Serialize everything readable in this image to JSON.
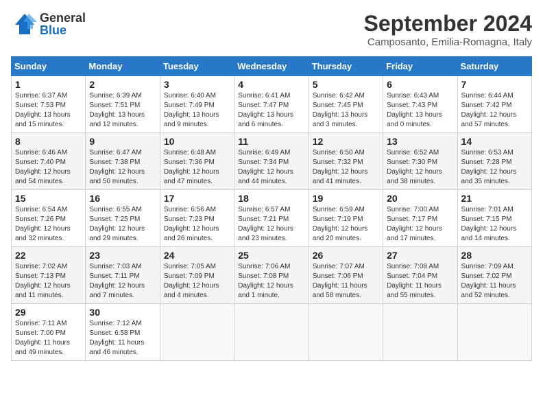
{
  "header": {
    "logo_general": "General",
    "logo_blue": "Blue",
    "title": "September 2024",
    "subtitle": "Camposanto, Emilia-Romagna, Italy"
  },
  "weekdays": [
    "Sunday",
    "Monday",
    "Tuesday",
    "Wednesday",
    "Thursday",
    "Friday",
    "Saturday"
  ],
  "weeks": [
    [
      {
        "day": "1",
        "sunrise": "Sunrise: 6:37 AM",
        "sunset": "Sunset: 7:53 PM",
        "daylight": "Daylight: 13 hours and 15 minutes."
      },
      {
        "day": "2",
        "sunrise": "Sunrise: 6:39 AM",
        "sunset": "Sunset: 7:51 PM",
        "daylight": "Daylight: 13 hours and 12 minutes."
      },
      {
        "day": "3",
        "sunrise": "Sunrise: 6:40 AM",
        "sunset": "Sunset: 7:49 PM",
        "daylight": "Daylight: 13 hours and 9 minutes."
      },
      {
        "day": "4",
        "sunrise": "Sunrise: 6:41 AM",
        "sunset": "Sunset: 7:47 PM",
        "daylight": "Daylight: 13 hours and 6 minutes."
      },
      {
        "day": "5",
        "sunrise": "Sunrise: 6:42 AM",
        "sunset": "Sunset: 7:45 PM",
        "daylight": "Daylight: 13 hours and 3 minutes."
      },
      {
        "day": "6",
        "sunrise": "Sunrise: 6:43 AM",
        "sunset": "Sunset: 7:43 PM",
        "daylight": "Daylight: 13 hours and 0 minutes."
      },
      {
        "day": "7",
        "sunrise": "Sunrise: 6:44 AM",
        "sunset": "Sunset: 7:42 PM",
        "daylight": "Daylight: 12 hours and 57 minutes."
      }
    ],
    [
      {
        "day": "8",
        "sunrise": "Sunrise: 6:46 AM",
        "sunset": "Sunset: 7:40 PM",
        "daylight": "Daylight: 12 hours and 54 minutes."
      },
      {
        "day": "9",
        "sunrise": "Sunrise: 6:47 AM",
        "sunset": "Sunset: 7:38 PM",
        "daylight": "Daylight: 12 hours and 50 minutes."
      },
      {
        "day": "10",
        "sunrise": "Sunrise: 6:48 AM",
        "sunset": "Sunset: 7:36 PM",
        "daylight": "Daylight: 12 hours and 47 minutes."
      },
      {
        "day": "11",
        "sunrise": "Sunrise: 6:49 AM",
        "sunset": "Sunset: 7:34 PM",
        "daylight": "Daylight: 12 hours and 44 minutes."
      },
      {
        "day": "12",
        "sunrise": "Sunrise: 6:50 AM",
        "sunset": "Sunset: 7:32 PM",
        "daylight": "Daylight: 12 hours and 41 minutes."
      },
      {
        "day": "13",
        "sunrise": "Sunrise: 6:52 AM",
        "sunset": "Sunset: 7:30 PM",
        "daylight": "Daylight: 12 hours and 38 minutes."
      },
      {
        "day": "14",
        "sunrise": "Sunrise: 6:53 AM",
        "sunset": "Sunset: 7:28 PM",
        "daylight": "Daylight: 12 hours and 35 minutes."
      }
    ],
    [
      {
        "day": "15",
        "sunrise": "Sunrise: 6:54 AM",
        "sunset": "Sunset: 7:26 PM",
        "daylight": "Daylight: 12 hours and 32 minutes."
      },
      {
        "day": "16",
        "sunrise": "Sunrise: 6:55 AM",
        "sunset": "Sunset: 7:25 PM",
        "daylight": "Daylight: 12 hours and 29 minutes."
      },
      {
        "day": "17",
        "sunrise": "Sunrise: 6:56 AM",
        "sunset": "Sunset: 7:23 PM",
        "daylight": "Daylight: 12 hours and 26 minutes."
      },
      {
        "day": "18",
        "sunrise": "Sunrise: 6:57 AM",
        "sunset": "Sunset: 7:21 PM",
        "daylight": "Daylight: 12 hours and 23 minutes."
      },
      {
        "day": "19",
        "sunrise": "Sunrise: 6:59 AM",
        "sunset": "Sunset: 7:19 PM",
        "daylight": "Daylight: 12 hours and 20 minutes."
      },
      {
        "day": "20",
        "sunrise": "Sunrise: 7:00 AM",
        "sunset": "Sunset: 7:17 PM",
        "daylight": "Daylight: 12 hours and 17 minutes."
      },
      {
        "day": "21",
        "sunrise": "Sunrise: 7:01 AM",
        "sunset": "Sunset: 7:15 PM",
        "daylight": "Daylight: 12 hours and 14 minutes."
      }
    ],
    [
      {
        "day": "22",
        "sunrise": "Sunrise: 7:02 AM",
        "sunset": "Sunset: 7:13 PM",
        "daylight": "Daylight: 12 hours and 11 minutes."
      },
      {
        "day": "23",
        "sunrise": "Sunrise: 7:03 AM",
        "sunset": "Sunset: 7:11 PM",
        "daylight": "Daylight: 12 hours and 7 minutes."
      },
      {
        "day": "24",
        "sunrise": "Sunrise: 7:05 AM",
        "sunset": "Sunset: 7:09 PM",
        "daylight": "Daylight: 12 hours and 4 minutes."
      },
      {
        "day": "25",
        "sunrise": "Sunrise: 7:06 AM",
        "sunset": "Sunset: 7:08 PM",
        "daylight": "Daylight: 12 hours and 1 minute."
      },
      {
        "day": "26",
        "sunrise": "Sunrise: 7:07 AM",
        "sunset": "Sunset: 7:06 PM",
        "daylight": "Daylight: 11 hours and 58 minutes."
      },
      {
        "day": "27",
        "sunrise": "Sunrise: 7:08 AM",
        "sunset": "Sunset: 7:04 PM",
        "daylight": "Daylight: 11 hours and 55 minutes."
      },
      {
        "day": "28",
        "sunrise": "Sunrise: 7:09 AM",
        "sunset": "Sunset: 7:02 PM",
        "daylight": "Daylight: 11 hours and 52 minutes."
      }
    ],
    [
      {
        "day": "29",
        "sunrise": "Sunrise: 7:11 AM",
        "sunset": "Sunset: 7:00 PM",
        "daylight": "Daylight: 11 hours and 49 minutes."
      },
      {
        "day": "30",
        "sunrise": "Sunrise: 7:12 AM",
        "sunset": "Sunset: 6:58 PM",
        "daylight": "Daylight: 11 hours and 46 minutes."
      },
      null,
      null,
      null,
      null,
      null
    ]
  ]
}
